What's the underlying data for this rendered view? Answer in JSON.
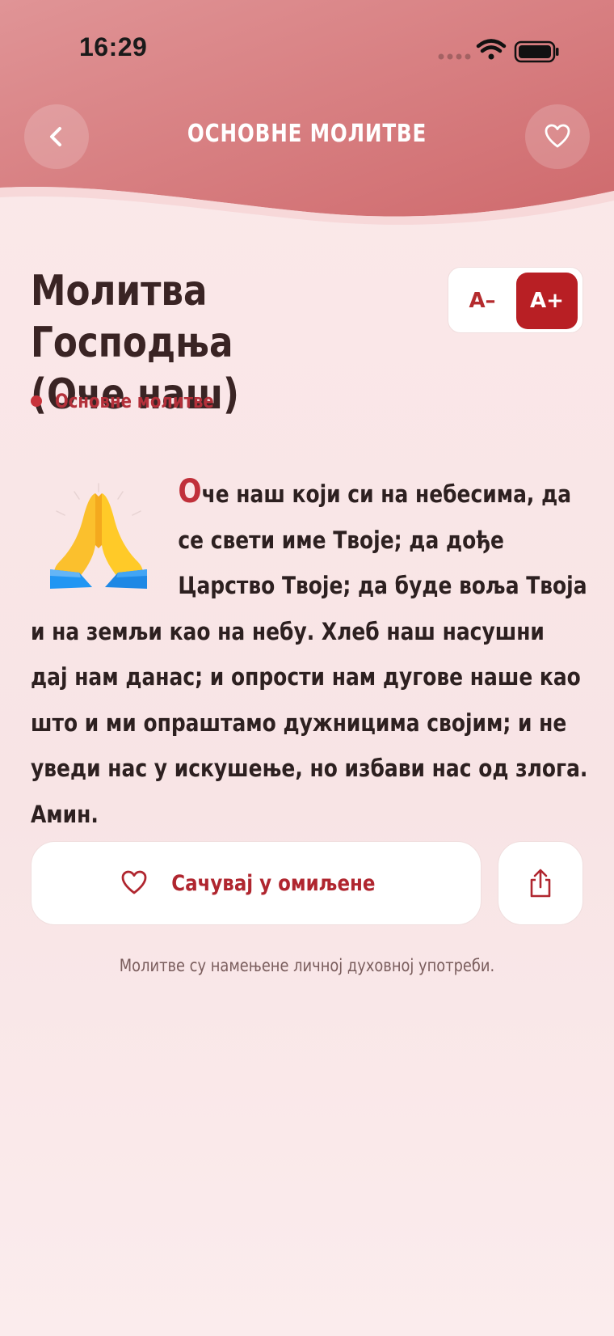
{
  "status_bar": {
    "time": "16:29",
    "icons": [
      "signal-dots-icon",
      "wifi-icon",
      "battery-icon"
    ]
  },
  "nav": {
    "title": "ОСНОВНЕ МОЛИТВЕ",
    "back_icon": "chevron-left-icon",
    "favorite_icon": "heart-outline-icon"
  },
  "prayer": {
    "title_line1": "Молитва Господња",
    "title_line2": "(Оче наш)",
    "category": "Основне молитве",
    "illustration": "praying-hands-emoji",
    "dropcap": "О",
    "body": "че наш који си на небесима, да се свети име Твоје; да дође Царство Твоје; да буде воља Твоја и на земљи као на небу. Хлеб наш насушни дај нам данас; и опрости нам дугове наше као што и ми опраштамо дужницима својим; и не уведи нас у искушење, но избави нас од злога. Амин."
  },
  "font_controls": {
    "decrease_label": "A–",
    "increase_label": "A+"
  },
  "actions": {
    "save_label": "Сачувај у омиљене",
    "save_icon": "heart-outline-icon",
    "share_icon": "share-icon"
  },
  "footer": {
    "note": "Молитве су намењене личној духовној употреби."
  },
  "colors": {
    "header_top": "#dd8a8c",
    "accent": "#b81f24",
    "background": "#fbe9ea"
  }
}
